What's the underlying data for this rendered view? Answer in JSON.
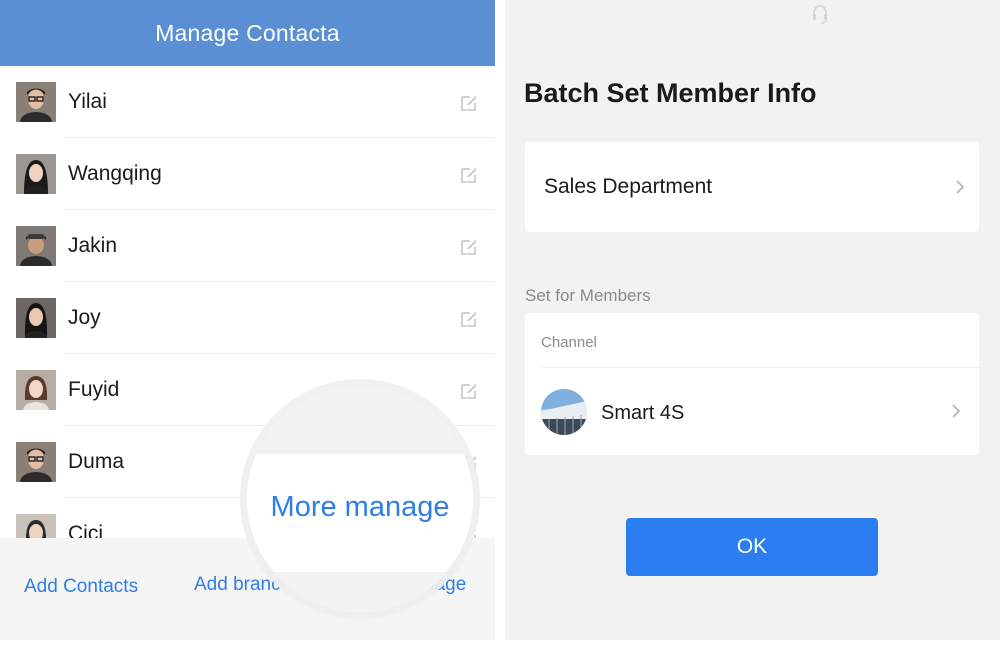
{
  "left": {
    "header_title": "Manage Contacta",
    "contacts": [
      {
        "name": "Yilai",
        "avatar": "man-glasses"
      },
      {
        "name": "Wangqing",
        "avatar": "woman-long-hair"
      },
      {
        "name": "Jakin",
        "avatar": "man-cap"
      },
      {
        "name": "Joy",
        "avatar": "woman-dark-hair"
      },
      {
        "name": "Fuyid",
        "avatar": "woman-light"
      },
      {
        "name": "Duma",
        "avatar": "man-glasses"
      },
      {
        "name": "Cici",
        "avatar": "woman-partial"
      }
    ],
    "footer": {
      "add_contacts": "Add Contacts",
      "add_branch_visible": "Add branc",
      "manage_visible": "nage"
    },
    "magnifier_text": "More manage"
  },
  "right": {
    "title": "Batch Set Member Info",
    "department": "Sales Department",
    "section_label": "Set for Members",
    "channel_label": "Channel",
    "channel_name": "Smart 4S",
    "ok_label": "OK"
  },
  "colors": {
    "header_blue": "#5b8fd4",
    "link_blue": "#2f7ee6",
    "button_blue": "#2a7ef0",
    "panel_gray": "#f2f2f2"
  }
}
